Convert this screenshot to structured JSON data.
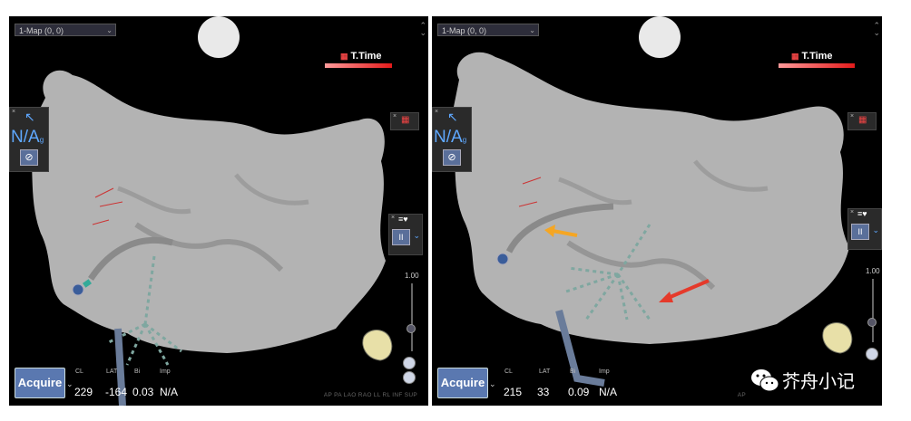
{
  "panels": [
    {
      "map_dropdown": "1-Map (0, 0)",
      "ttime_label": "T.Time",
      "na_label": "N/A",
      "na_subscript": "g",
      "slider_top_value": "1.00",
      "acquire_label": "Acquire",
      "headers": {
        "cl": "CL",
        "lat": "LAT",
        "bi": "Bi",
        "imp": "Imp"
      },
      "values": {
        "cl": "229",
        "lat": "-164",
        "bi": "0.03",
        "imp": "N/A"
      },
      "views": "AP PA LAO RAO LL RL INF SUP"
    },
    {
      "map_dropdown": "1-Map (0, 0)",
      "ttime_label": "T.Time",
      "na_label": "N/A",
      "na_subscript": "g",
      "slider_top_value": "1.00",
      "acquire_label": "Acquire",
      "headers": {
        "cl": "CL",
        "lat": "LAT",
        "bi": "Bi",
        "imp": "Imp"
      },
      "values": {
        "cl": "215",
        "lat": "33",
        "bi": "0.09",
        "imp": "N/A"
      },
      "views": "AP"
    }
  ],
  "watermark": "芥舟小记",
  "colors": {
    "accent_blue": "#5fa8ff",
    "ttime_red": "#e31b1b",
    "arrow_orange": "#f5a623",
    "arrow_red": "#e53a2b"
  }
}
